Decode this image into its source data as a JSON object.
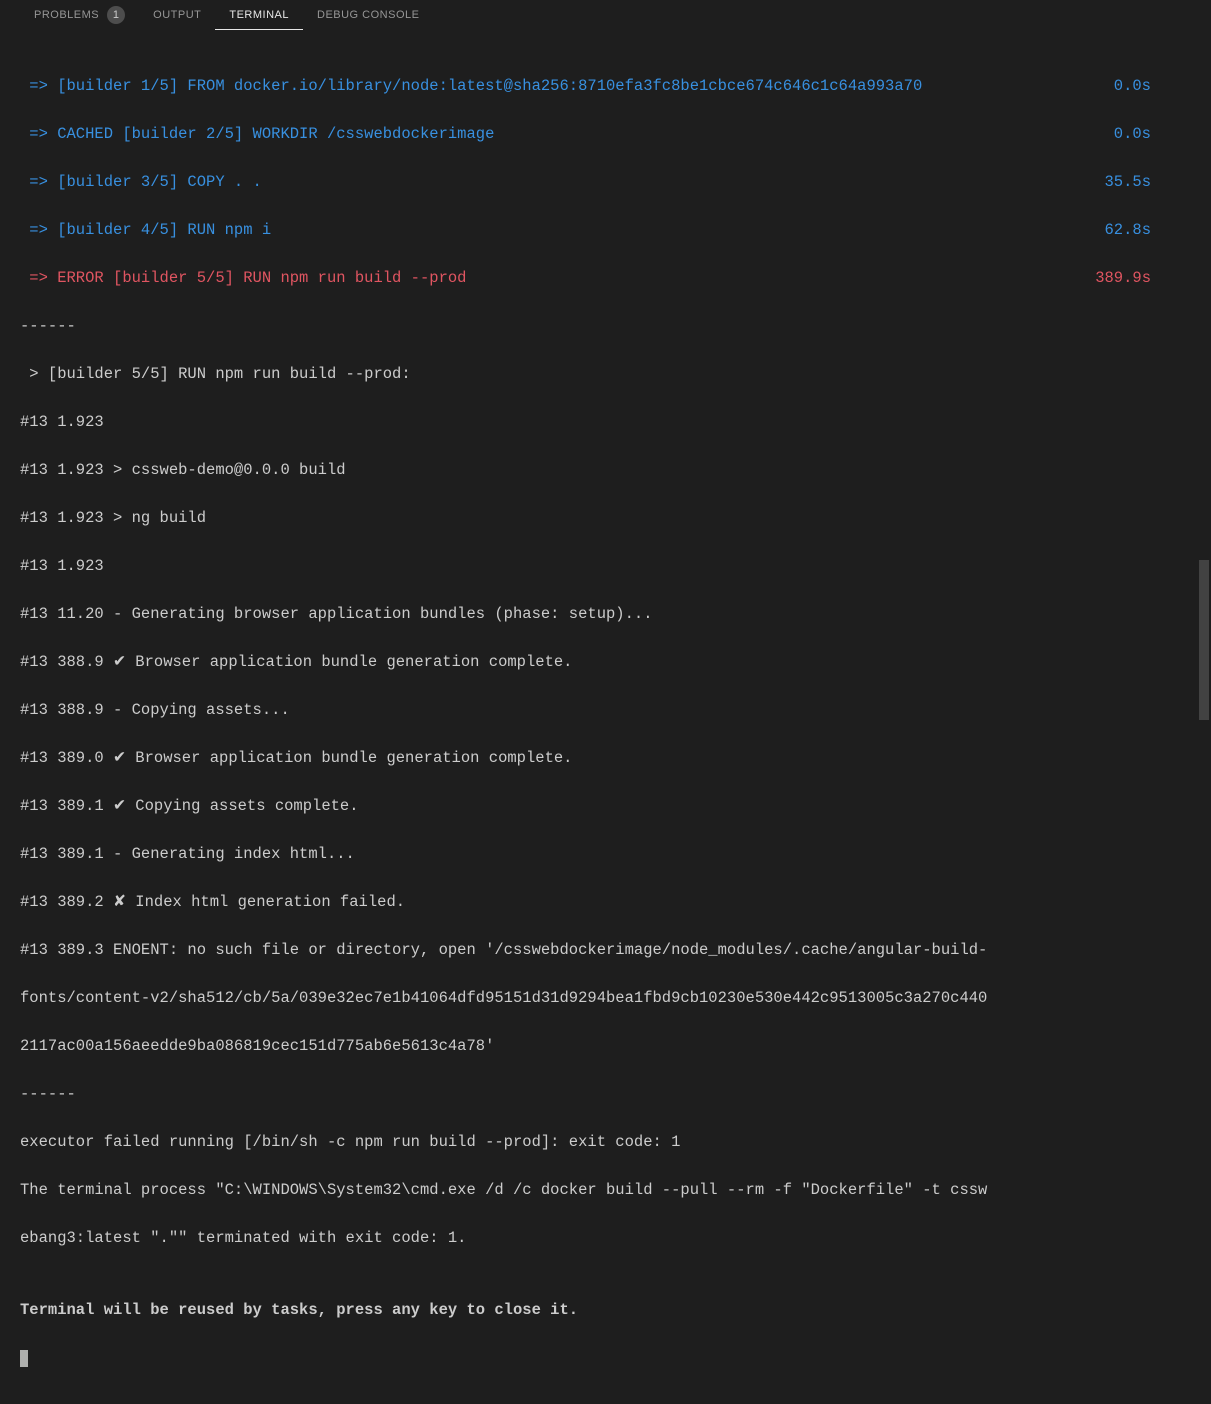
{
  "tabs": {
    "problems": "PROBLEMS",
    "problems_count": "1",
    "output": "OUTPUT",
    "terminal": "TERMINAL",
    "debug_console": "DEBUG CONSOLE"
  },
  "build": {
    "line1": {
      "text": " => [builder 1/5] FROM docker.io/library/node:latest@sha256:8710efa3fc8be1cbce674c646c1c64a993a70",
      "time": "0.0s"
    },
    "line2": {
      "text": " => CACHED [builder 2/5] WORKDIR /csswebdockerimage",
      "time": "0.0s"
    },
    "line3": {
      "text": " => [builder 3/5] COPY . .",
      "time": "35.5s"
    },
    "line4": {
      "text": " => [builder 4/5] RUN npm i",
      "time": "62.8s"
    },
    "line5": {
      "text": " => ERROR [builder 5/5] RUN npm run build --prod",
      "time": "389.9s"
    }
  },
  "log": {
    "sep1": "------",
    "header": " > [builder 5/5] RUN npm run build --prod:",
    "l1": "#13 1.923",
    "l2": "#13 1.923 > cssweb-demo@0.0.0 build",
    "l3": "#13 1.923 > ng build",
    "l4": "#13 1.923",
    "l5": "#13 11.20 - Generating browser application bundles (phase: setup)...",
    "l6": "#13 388.9 ✔ Browser application bundle generation complete.",
    "l7": "#13 388.9 - Copying assets...",
    "l8": "#13 389.0 ✔ Browser application bundle generation complete.",
    "l9": "#13 389.1 ✔ Copying assets complete.",
    "l10": "#13 389.1 - Generating index html...",
    "l11": "#13 389.2 ✘ Index html generation failed.",
    "l12": "#13 389.3 ENOENT: no such file or directory, open '/csswebdockerimage/node_modules/.cache/angular-build-",
    "l13": "fonts/content-v2/sha512/cb/5a/039e32ec7e1b41064dfd95151d31d9294bea1fbd9cb10230e530e442c9513005c3a270c440",
    "l14": "2117ac00a156aeedde9ba086819cec151d775ab6e5613c4a78'",
    "sep2": "------",
    "exec1": "executor failed running [/bin/sh -c npm run build --prod]: exit code: 1",
    "exec2": "The terminal process \"C:\\WINDOWS\\System32\\cmd.exe /d /c docker build --pull --rm -f \"Dockerfile\" -t cssw",
    "exec3": "ebang3:latest \".\"\" terminated with exit code: 1.",
    "blank": "",
    "reuse": "Terminal will be reused by tasks, press any key to close it."
  }
}
